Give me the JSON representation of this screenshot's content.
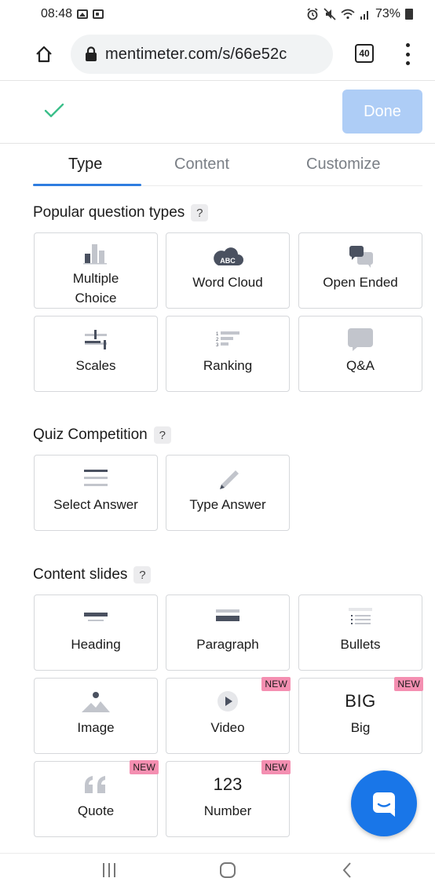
{
  "status_bar": {
    "time": "08:48",
    "battery": "73%"
  },
  "browser": {
    "url": "mentimeter.com/s/66e52c",
    "tab_count": "40"
  },
  "toolbar": {
    "done_label": "Done"
  },
  "tabs": [
    {
      "label": "Type",
      "active": true
    },
    {
      "label": "Content",
      "active": false
    },
    {
      "label": "Customize",
      "active": false
    }
  ],
  "sections": {
    "popular": {
      "title": "Popular question types",
      "help": "?",
      "cards": [
        {
          "label_line1": "Multiple",
          "label_line2": "Choice",
          "icon": "bar-chart-icon"
        },
        {
          "label": "Word Cloud",
          "icon": "word-cloud-icon",
          "icon_text": "ABC"
        },
        {
          "label": "Open Ended",
          "icon": "speech-bubbles-icon"
        },
        {
          "label": "Scales",
          "icon": "scales-icon"
        },
        {
          "label": "Ranking",
          "icon": "ranking-icon",
          "icon_digits": [
            "1",
            "2",
            "3"
          ]
        },
        {
          "label": "Q&A",
          "icon": "chat-bubble-icon"
        }
      ]
    },
    "quiz": {
      "title": "Quiz Competition",
      "help": "?",
      "cards": [
        {
          "label": "Select Answer",
          "icon": "list-lines-icon"
        },
        {
          "label": "Type Answer",
          "icon": "pencil-icon"
        }
      ]
    },
    "content": {
      "title": "Content slides",
      "help": "?",
      "new_label": "NEW",
      "cards": [
        {
          "label": "Heading",
          "icon": "heading-icon"
        },
        {
          "label": "Paragraph",
          "icon": "paragraph-icon"
        },
        {
          "label": "Bullets",
          "icon": "bullets-icon"
        },
        {
          "label": "Image",
          "icon": "image-icon"
        },
        {
          "label": "Video",
          "icon": "play-icon",
          "is_new": true
        },
        {
          "label": "Big",
          "icon": "big-text-icon",
          "icon_text": "BIG",
          "is_new": true
        },
        {
          "label": "Quote",
          "icon": "quote-icon",
          "is_new": true
        },
        {
          "label": "Number",
          "icon": "number-icon",
          "icon_text": "123",
          "is_new": true
        }
      ]
    }
  },
  "colors": {
    "accent": "#2e7de0",
    "done_button": "#aecdf6",
    "check": "#3bbf8a",
    "icon_gray": "#4a5160",
    "icon_light": "#c2c5cc",
    "new_badge": "#f48fb1",
    "chat_fab": "#1976e8"
  }
}
